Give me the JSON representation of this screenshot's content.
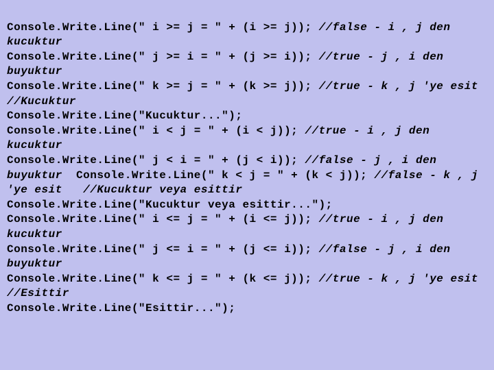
{
  "lines": [
    {
      "code": "Console.Write.Line(\" i >= j = \" + (i >= j)); ",
      "comment": "//false - i , j den kucuktur"
    },
    {
      "code": "Console.Write.Line(\" j >= i = \" + (j >= i)); ",
      "comment": "//true - j , i den buyuktur"
    },
    {
      "code": "Console.Write.Line(\" k >= j = \" + (k >= j)); ",
      "comment": "//true - k , j 'ye esit   //Kucuktur"
    },
    {
      "code": "Console.Write.Line(\"Kucuktur...\");",
      "comment": ""
    },
    {
      "code": "Console.Write.Line(\" i < j = \" + (i < j)); ",
      "comment": "//true - i , j den kucuktur"
    },
    {
      "code": "Console.Write.Line(\" j < i = \" + (j < i)); ",
      "comment": "//false - j , i den buyuktur"
    },
    {
      "inline_code_1": "  Console.Write.Line(\" k < j = \" + (k < j)); ",
      "inline_comment_1": "//false - k , j 'ye esit   //Kucuktur veya esittir"
    },
    {
      "code": "Console.Write.Line(\"Kucuktur veya esittir...\");",
      "comment": ""
    },
    {
      "code": "Console.Write.Line(\" i <= j = \" + (i <= j)); ",
      "comment": "//true - i , j den kucuktur"
    },
    {
      "code": "Console.Write.Line(\" j <= i = \" + (j <= i)); ",
      "comment": "//false - j , i den buyuktur"
    },
    {
      "code": "Console.Write.Line(\" k <= j = \" + (k <= j)); ",
      "comment": "//true - k , j 'ye esit  //Esittir"
    },
    {
      "code": "Console.Write.Line(\"Esittir...\");",
      "comment": ""
    }
  ]
}
